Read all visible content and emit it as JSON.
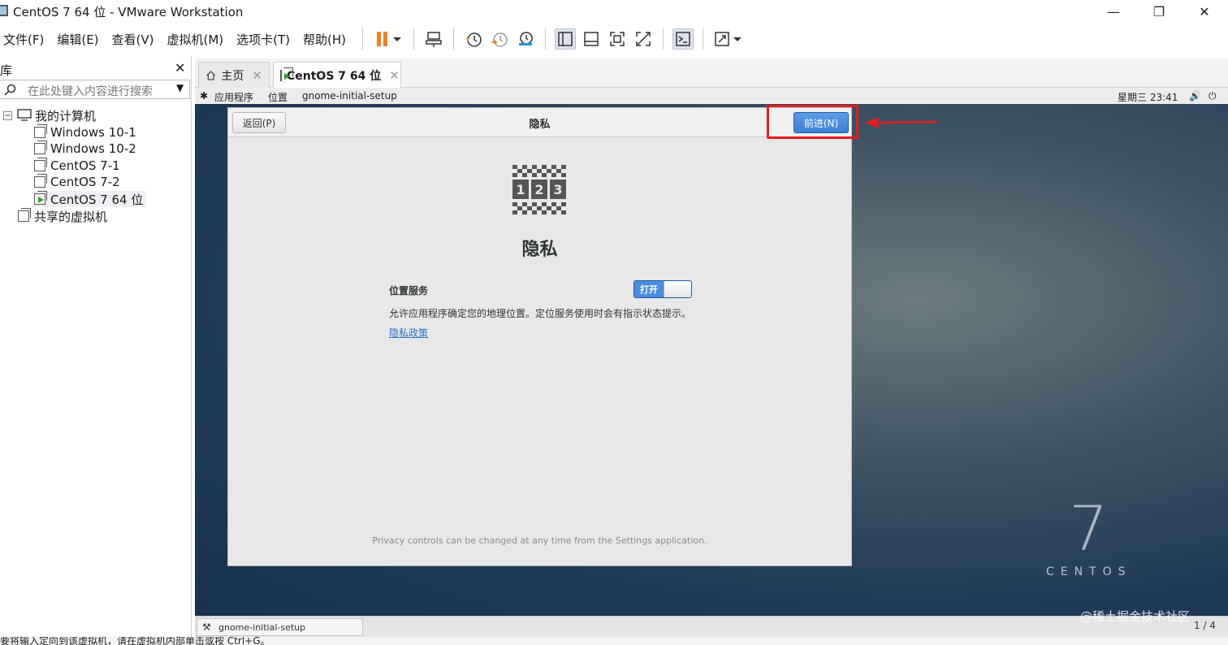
{
  "window": {
    "title": "CentOS 7 64 位 - VMware Workstation",
    "minimize": "—",
    "restore": "❐",
    "close": "✕"
  },
  "menu": {
    "file": "文件(F)",
    "edit": "编辑(E)",
    "view": "查看(V)",
    "vm": "虚拟机(M)",
    "tabs": "选项卡(T)",
    "help": "帮助(H)"
  },
  "library": {
    "title": "库",
    "close": "✕",
    "search_placeholder": "在此处键入内容进行搜索",
    "my_computer": "我的计算机",
    "vms": [
      "Windows 10-1",
      "Windows 10-2",
      "CentOS 7-1",
      "CentOS 7-2",
      "CentOS 7 64 位"
    ],
    "shared": "共享的虚拟机"
  },
  "tabs": {
    "home": "主页",
    "vm": "CentOS 7 64 位"
  },
  "gnome_bar": {
    "apps": "应用程序",
    "places": "位置",
    "current": "gnome-initial-setup",
    "clock": "星期三 23:41"
  },
  "dialog": {
    "back": "返回(P)",
    "title": "隐私",
    "next": "前进(N)",
    "heading": "隐私",
    "location_label": "位置服务",
    "toggle_on": "打开",
    "location_desc": "允许应用程序确定您的地理位置。定位服务使用时会有指示状态提示。",
    "policy_link": "隐私政策",
    "footnote": "Privacy controls can be changed at any time from the Settings application."
  },
  "branding": {
    "number": "7",
    "word": "CENTOS"
  },
  "vm_taskbar": {
    "item": "gnome-initial-setup",
    "page": "1 / 4"
  },
  "status_bar": {
    "text": "要将输入定向到该虚拟机，请在虚拟机内部单击或按 Ctrl+G。"
  },
  "watermark": "@稀土掘金技术社区",
  "colors": {
    "accent_blue": "#3b7fd4",
    "highlight_red": "#e81b1b",
    "link": "#2a76c6"
  }
}
